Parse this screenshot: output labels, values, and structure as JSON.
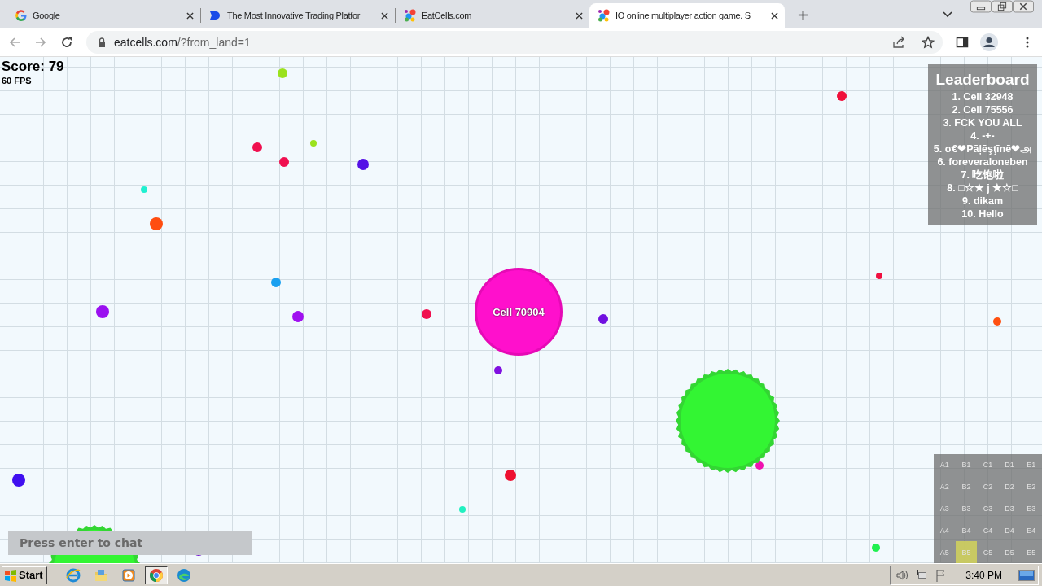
{
  "tabs": [
    {
      "title": "Google",
      "kind": "google",
      "selected": false
    },
    {
      "title": "The Most Innovative Trading Platfor",
      "kind": "brand",
      "selected": false
    },
    {
      "title": "EatCells.com",
      "kind": "dots",
      "selected": false
    },
    {
      "title": "IO online multiplayer action game. S",
      "kind": "dots",
      "selected": true
    }
  ],
  "address_bar": {
    "host": "eatcells.com",
    "path": "/?from_land=1"
  },
  "game": {
    "score": "Score: 79",
    "fps": "60 FPS",
    "player": {
      "name": "Cell 70904"
    },
    "leaderboard": {
      "title": "Leaderboard",
      "entries": [
        "1. Cell 32948",
        "2. Cell 75556",
        "3. FCK YOU ALL",
        "4. -+-",
        "5. σ€❤Pāļēşţīnē❤அ",
        "6. foreveraloneben",
        "7. 吃饱啦",
        "8. □☆★ j ★☆□",
        "9. dikam",
        "10. Hello"
      ]
    },
    "minimap": {
      "rows": [
        [
          {
            "label": "A1",
            "selected": false
          },
          {
            "label": "B1",
            "selected": false
          },
          {
            "label": "C1",
            "selected": false
          },
          {
            "label": "D1",
            "selected": false
          },
          {
            "label": "E1",
            "selected": false
          }
        ],
        [
          {
            "label": "A2",
            "selected": false
          },
          {
            "label": "B2",
            "selected": false
          },
          {
            "label": "C2",
            "selected": false
          },
          {
            "label": "D2",
            "selected": false
          },
          {
            "label": "E2",
            "selected": false
          }
        ],
        [
          {
            "label": "A3",
            "selected": false
          },
          {
            "label": "B3",
            "selected": false
          },
          {
            "label": "C3",
            "selected": false
          },
          {
            "label": "D3",
            "selected": false
          },
          {
            "label": "E3",
            "selected": false
          }
        ],
        [
          {
            "label": "A4",
            "selected": false
          },
          {
            "label": "B4",
            "selected": false
          },
          {
            "label": "C4",
            "selected": false
          },
          {
            "label": "D4",
            "selected": false
          },
          {
            "label": "E4",
            "selected": false
          }
        ],
        [
          {
            "label": "A5",
            "selected": false
          },
          {
            "label": "B5",
            "selected": true
          },
          {
            "label": "C5",
            "selected": false
          },
          {
            "label": "D5",
            "selected": false
          },
          {
            "label": "E5",
            "selected": false
          }
        ]
      ]
    },
    "chat": {
      "placeholder": "Press enter to chat"
    }
  },
  "taskbar": {
    "start": "Start",
    "apps": [
      {
        "kind": "ie",
        "selected": false
      },
      {
        "kind": "folder",
        "selected": false
      },
      {
        "kind": "media",
        "selected": false
      },
      {
        "kind": "chrome",
        "selected": true
      },
      {
        "kind": "edge",
        "selected": false
      }
    ],
    "clock": "3:40 PM"
  }
}
